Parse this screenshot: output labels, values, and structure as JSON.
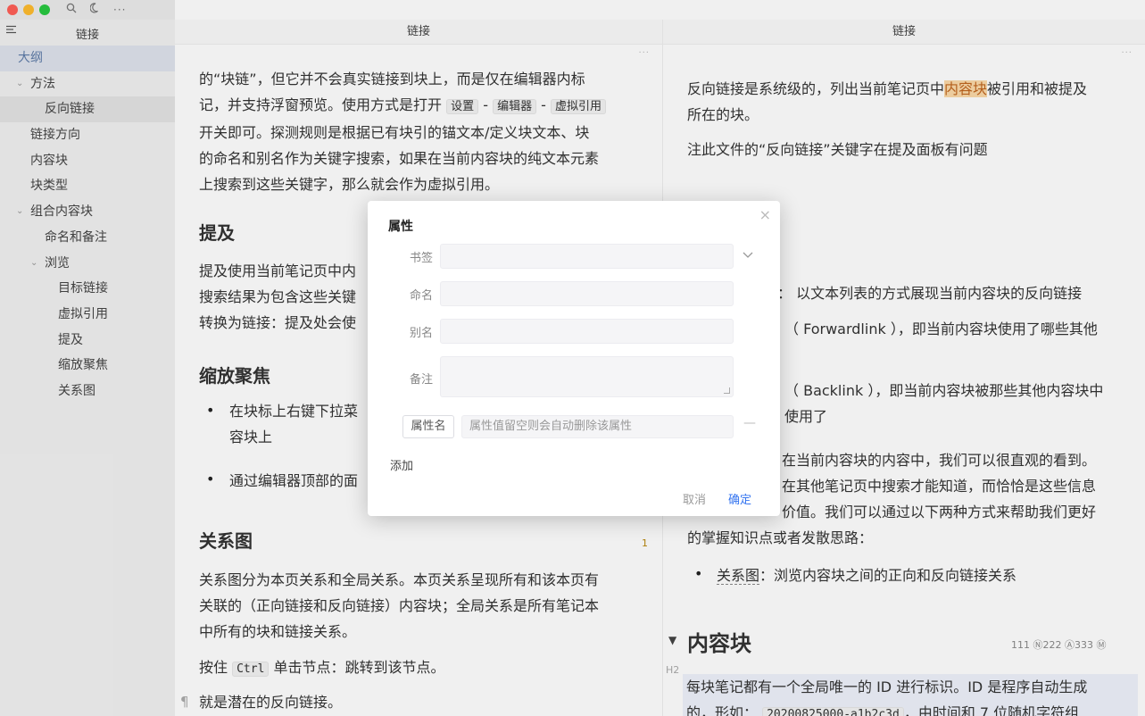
{
  "window": {
    "menu_icon": "menu-icon",
    "search_icon": "search-icon",
    "theme_icon": "moon-icon",
    "more_label": "···"
  },
  "sidebar": {
    "title": "链接",
    "items": [
      {
        "label": "大纲"
      },
      {
        "label": "方法"
      },
      {
        "label": "反向链接"
      },
      {
        "label": "链接方向"
      },
      {
        "label": "内容块"
      },
      {
        "label": "块类型"
      },
      {
        "label": "组合内容块"
      },
      {
        "label": "命名和备注"
      },
      {
        "label": "浏览"
      },
      {
        "label": "目标链接"
      },
      {
        "label": "虚拟引用"
      },
      {
        "label": "提及"
      },
      {
        "label": "缩放聚焦"
      },
      {
        "label": "关系图"
      }
    ]
  },
  "editor_mid": {
    "tab_title": "链接",
    "more": "···",
    "p1_line1": "的“块链”，但它并不会真实链接到块上，而是仅在编辑器内标",
    "p1_line2a": "记，并支持浮窗预览。使用方式是打开",
    "p1_code1": "设置",
    "p1_code2": "编辑器",
    "p1_code3": "虚拟引用",
    "p1_line3": "开关即可。探测规则是根据已有块引的锚文本/定义块文本、块",
    "p1_line4": "的命名和别名作为关键字搜索，如果在当前内容块的纯文本元素",
    "p1_line5": "上搜索到这些关键字，那么就会作为虚拟引用。",
    "h_mention": "提及",
    "p2_line1": "提及使用当前笔记页中内",
    "p2_line2": "搜索结果为包含这些关键",
    "p2_line3": "转换为链接：提及处会使",
    "h_zoom": "缩放聚焦",
    "li1_line1": "在块标上右键下拉菜",
    "li1_line2": "容块上",
    "li2": "通过编辑器顶部的面",
    "h_graph": "关系图",
    "graph_badge": "1",
    "p3_line1": "关系图分为本页关系和全局关系。本页关系呈现所有和该本页有",
    "p3_line2": "关联的（正向链接和反向链接）内容块；全局关系是所有笔记本",
    "p3_line3": "中所有的块和链接关系。",
    "p4_a": "按住",
    "p4_code": "Ctrl",
    "p4_b": "单击节点：跳转到该节点。",
    "para_mark": "¶",
    "p5": "就是潜在的反向链接。"
  },
  "editor_right": {
    "tab_title": "链接",
    "more": "···",
    "r1_a": "反向链接是系统级的，列出当前笔记页中",
    "r1_hl": "内容块",
    "r1_b": "被引用和被提及",
    "r1_line2": "所在的块。",
    "r2": "注此文件的“反向链接”关键字在提及面板有问题",
    "r3": "：  以文本列表的方式展现当前内容块的反向链接",
    "r4_line1": "（ Forwardlink ），即当前内容块使用了哪些其他",
    "r5_line1": "（ Backlink ），即当前内容块被那些其他内容块中",
    "r5_line2": "使用了",
    "r6_line1": "在当前内容块的内容中，我们可以很直观的看到。",
    "r6_line2": "在其他笔记页中搜索才能知道，而恰恰是这些信息",
    "r6_line3": "价值。我们可以通过以下两种方式来帮助我们更好",
    "r6_line4": "的掌握知识点或者发散思路：",
    "li_graph_term": "关系图",
    "li_graph_rest": "：浏览内容块之间的正向和反向链接关系",
    "h_block": "内容块",
    "h_block_meta": "111  Ⓝ222  Ⓐ333  Ⓜ",
    "h_marker": "H2",
    "b1_line1": "每块笔记都有一个全局唯一的 ID 进行标识。ID 是程序自动生成",
    "b1_line2a": "的，形如：",
    "b1_code": "20200825000-a1b2c3d",
    "b1_line2b": "，由时间和 7 位随机字符组"
  },
  "dialog": {
    "title": "属性",
    "close": "×",
    "bookmark_label": "书签",
    "name_label": "命名",
    "alias_label": "别名",
    "memo_label": "备注",
    "attr_name": "属性名",
    "attr_value_placeholder": "属性值留空则会自动删除该属性",
    "add_label": "添加",
    "cancel_label": "取消",
    "ok_label": "确定"
  }
}
